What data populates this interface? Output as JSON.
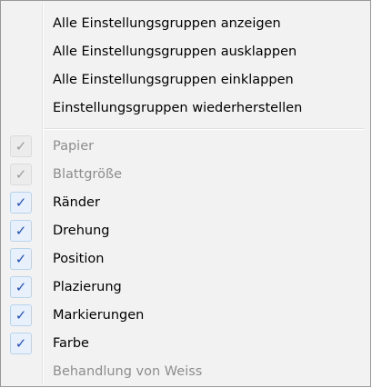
{
  "menu": {
    "actions": [
      {
        "label": "Alle Einstellungsgruppen anzeigen"
      },
      {
        "label": "Alle Einstellungsgruppen ausklappen"
      },
      {
        "label": "Alle Einstellungsgruppen einklappen"
      },
      {
        "label": "Einstellungsgruppen wiederherstellen"
      }
    ],
    "groups": [
      {
        "label": "Papier",
        "checked": true,
        "enabled": false
      },
      {
        "label": "Blattgröße",
        "checked": true,
        "enabled": false
      },
      {
        "label": "Ränder",
        "checked": true,
        "enabled": true
      },
      {
        "label": "Drehung",
        "checked": true,
        "enabled": true
      },
      {
        "label": "Position",
        "checked": true,
        "enabled": true
      },
      {
        "label": "Plazierung",
        "checked": true,
        "enabled": true
      },
      {
        "label": "Markierungen",
        "checked": true,
        "enabled": true
      },
      {
        "label": "Farbe",
        "checked": true,
        "enabled": true
      },
      {
        "label": "Behandlung von Weiss",
        "checked": false,
        "enabled": false
      }
    ],
    "check_glyph": "✓",
    "colors": {
      "check_active": "#1f4fc7",
      "check_inactive": "#9a9a9a",
      "disabled_text": "#8d8d8d"
    }
  }
}
